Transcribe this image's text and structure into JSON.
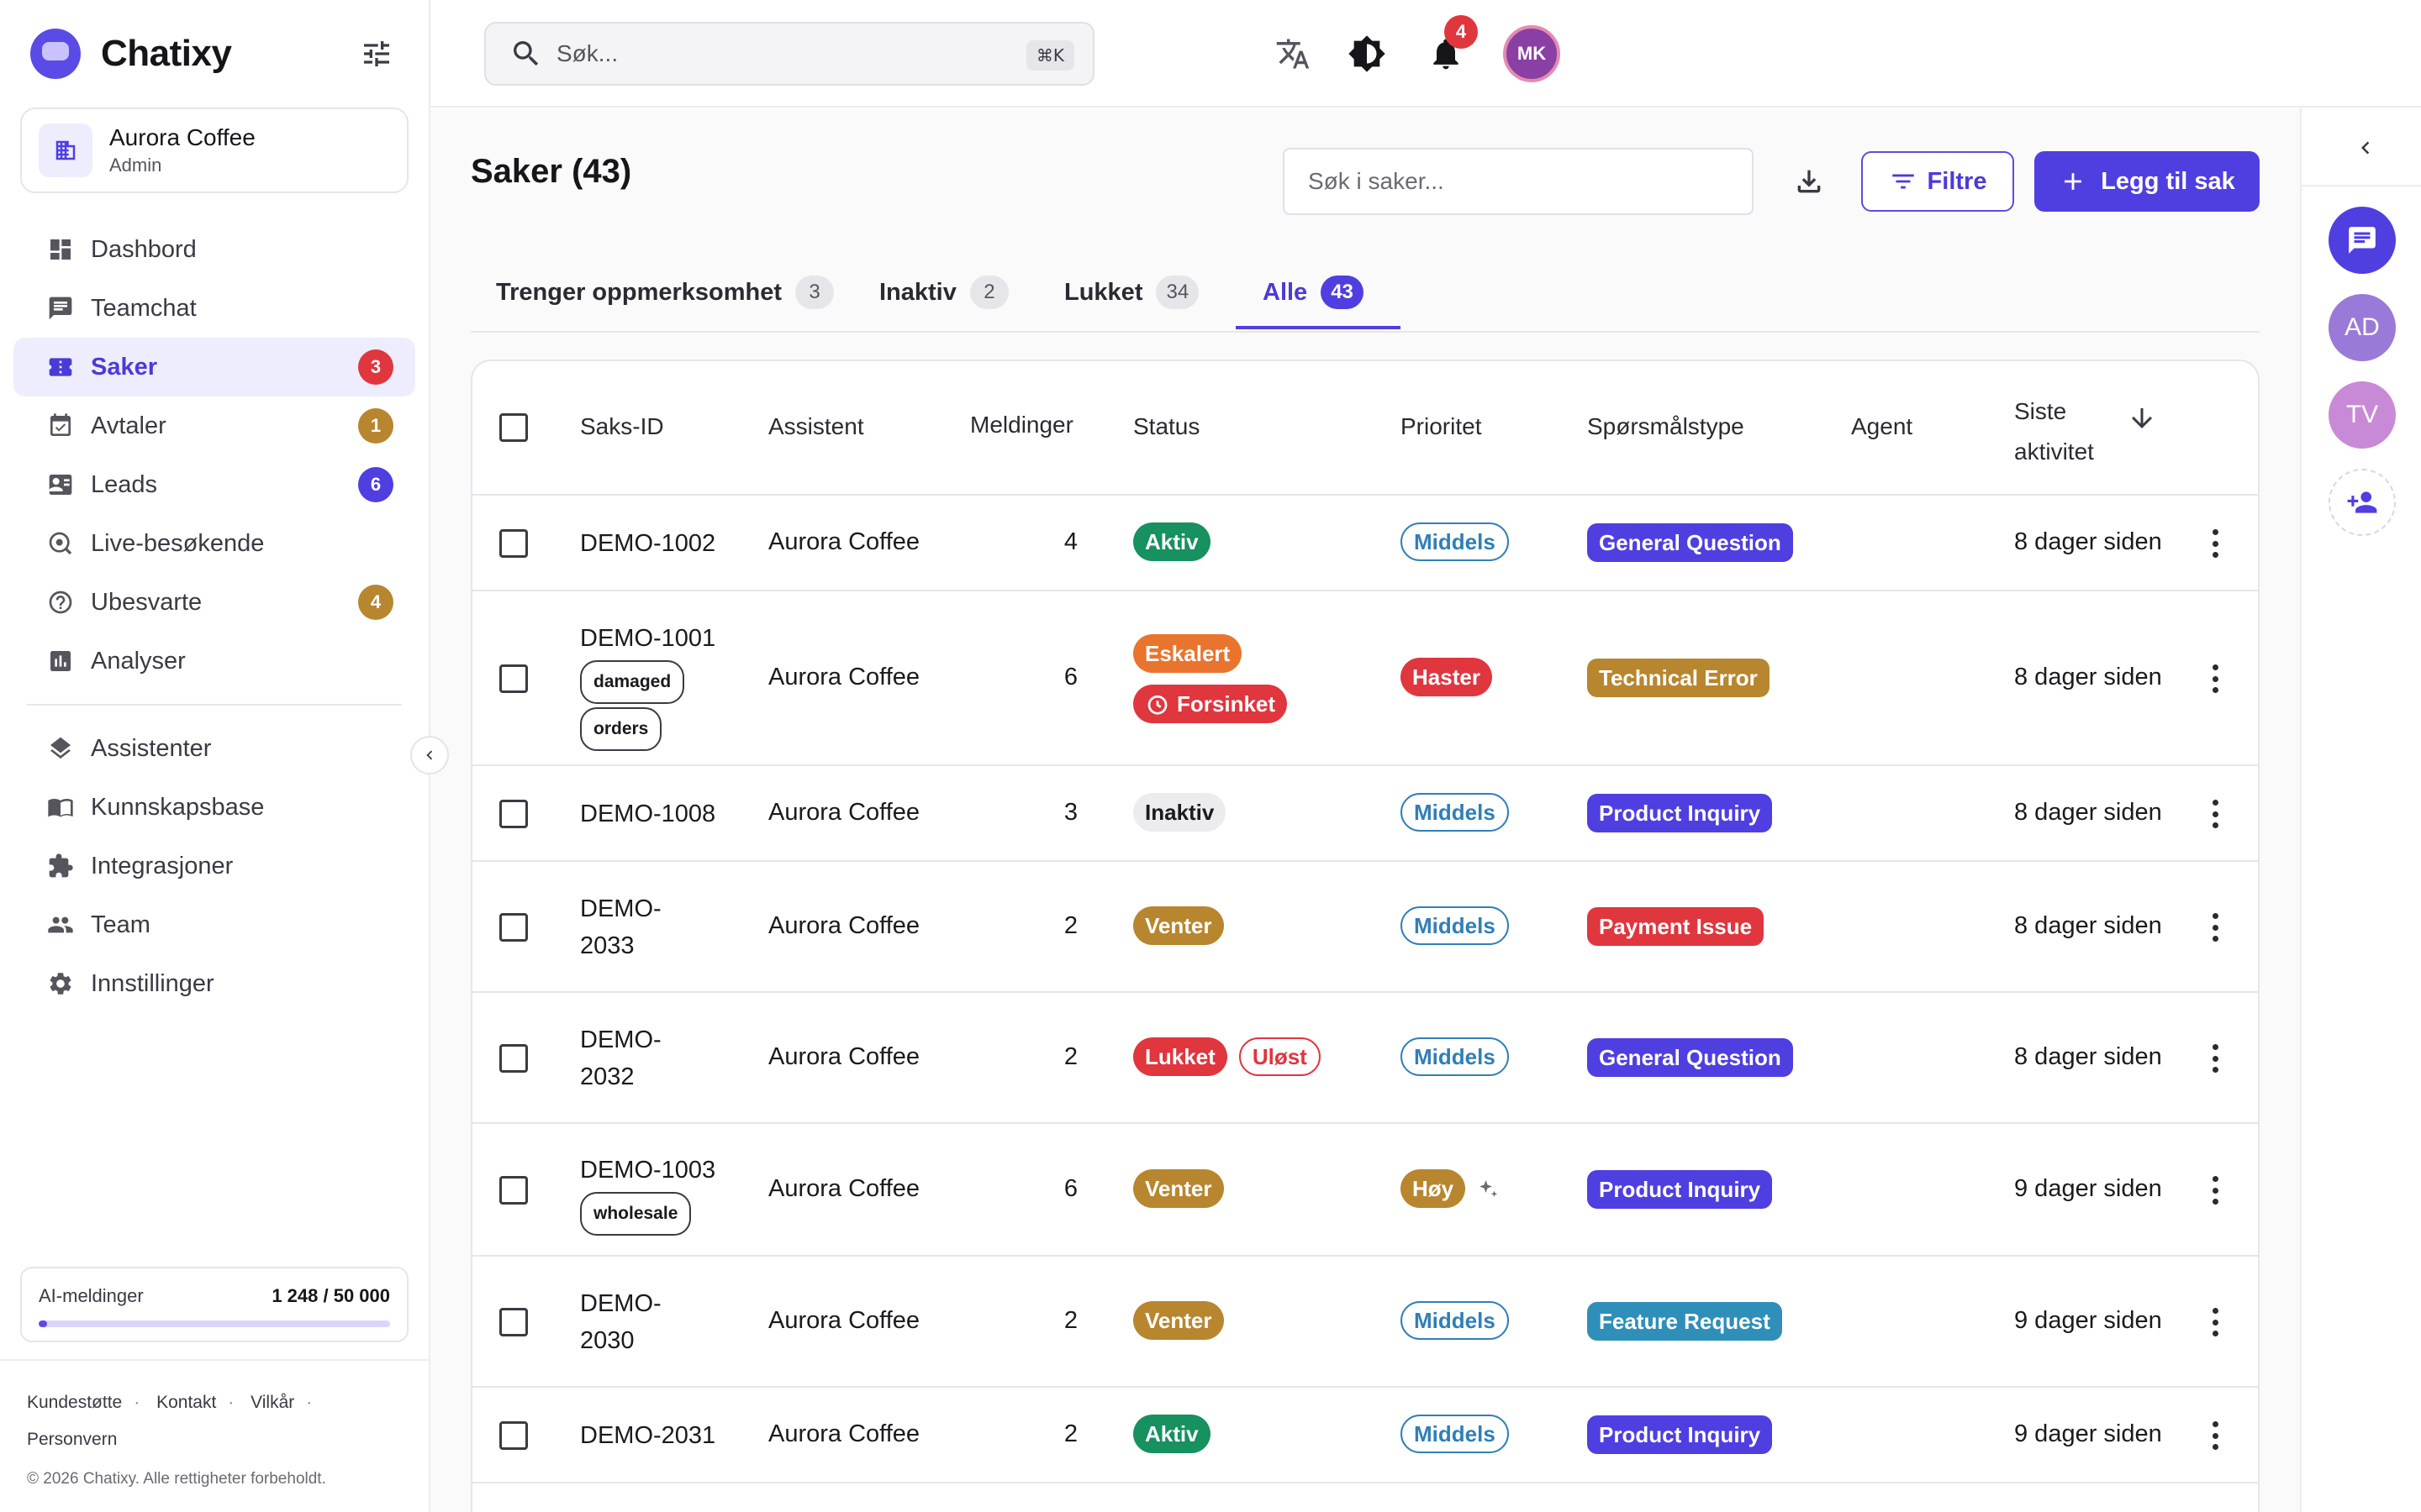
{
  "brand": {
    "name": "Chatixy"
  },
  "org": {
    "name": "Aurora Coffee",
    "role": "Admin"
  },
  "nav": {
    "items": [
      {
        "label": "Dashbord",
        "icon": "dashboard-icon"
      },
      {
        "label": "Teamchat",
        "icon": "chat-icon"
      },
      {
        "label": "Saker",
        "icon": "ticket-icon",
        "badge": "3",
        "active": true
      },
      {
        "label": "Avtaler",
        "icon": "calendar-icon",
        "badge": "1"
      },
      {
        "label": "Leads",
        "icon": "contact-card-icon",
        "badge": "6"
      },
      {
        "label": "Live-besøkende",
        "icon": "live-visitors-icon"
      },
      {
        "label": "Ubesvarte",
        "icon": "question-icon",
        "badge": "4"
      },
      {
        "label": "Analyser",
        "icon": "analytics-icon"
      }
    ],
    "items2": [
      {
        "label": "Assistenter",
        "icon": "layers-icon"
      },
      {
        "label": "Kunnskapsbase",
        "icon": "book-icon"
      },
      {
        "label": "Integrasjoner",
        "icon": "puzzle-icon"
      },
      {
        "label": "Team",
        "icon": "team-icon"
      },
      {
        "label": "Innstillinger",
        "icon": "gear-icon"
      }
    ]
  },
  "usage": {
    "label": "AI-meldinger",
    "value": "1 248 / 50 000",
    "fraction": 0.025
  },
  "footer": {
    "links": [
      "Kundestøtte",
      "Kontakt",
      "Vilkår",
      "Personvern"
    ],
    "copyright": "© 2026 Chatixy. Alle rettigheter forbeholdt."
  },
  "topbar": {
    "search_placeholder": "Søk...",
    "shortcut": "⌘K",
    "notification_count": "4",
    "avatar_initials": "MK"
  },
  "rail": {
    "avatars": [
      {
        "initials": "AD",
        "color": "#9a7ad8"
      },
      {
        "initials": "TV",
        "color": "#c88ad6"
      }
    ]
  },
  "page": {
    "title": "Saker (43)",
    "search_placeholder": "Søk i saker...",
    "filter_label": "Filtre",
    "add_label": "Legg til sak"
  },
  "tabs": [
    {
      "label": "Trenger oppmerksomhet",
      "count": "3"
    },
    {
      "label": "Inaktiv",
      "count": "2"
    },
    {
      "label": "Lukket",
      "count": "34"
    },
    {
      "label": "Alle",
      "count": "43",
      "active": true
    }
  ],
  "table": {
    "headers": {
      "id": "Saks-ID",
      "assistant": "Assistent",
      "messages": "Meldinger",
      "status": "Status",
      "priority": "Prioritet",
      "type": "Spørsmålstype",
      "agent": "Agent",
      "activity_line1": "Siste",
      "activity_line2": "aktivitet"
    },
    "rows": [
      {
        "id": "DEMO-1002",
        "tags": [],
        "assistant": "Aurora Coffee",
        "messages": "4",
        "status": [
          {
            "label": "Aktiv",
            "kind": "green"
          }
        ],
        "priority": {
          "label": "Middels",
          "kind": "outline"
        },
        "type": {
          "label": "General Question",
          "color": "#4f3fe0"
        },
        "activity": "8 dager siden"
      },
      {
        "id": "DEMO-1001",
        "tags": [
          "damaged",
          "orders"
        ],
        "assistant": "Aurora Coffee",
        "messages": "6",
        "status": [
          {
            "label": "Eskalert",
            "kind": "orange"
          },
          {
            "label": "Forsinket",
            "kind": "red-clock"
          }
        ],
        "priority": {
          "label": "Haster",
          "kind": "red"
        },
        "type": {
          "label": "Technical Error",
          "color": "#b8862e"
        },
        "activity": "8 dager siden"
      },
      {
        "id": "DEMO-1008",
        "tags": [],
        "assistant": "Aurora Coffee",
        "messages": "3",
        "status": [
          {
            "label": "Inaktiv",
            "kind": "grey"
          }
        ],
        "priority": {
          "label": "Middels",
          "kind": "outline"
        },
        "type": {
          "label": "Product Inquiry",
          "color": "#4f3fe0"
        },
        "activity": "8 dager siden"
      },
      {
        "id_line1": "DEMO-",
        "id_line2": "2033",
        "tags": [],
        "assistant": "Aurora Coffee",
        "messages": "2",
        "status": [
          {
            "label": "Venter",
            "kind": "amber"
          }
        ],
        "priority": {
          "label": "Middels",
          "kind": "outline"
        },
        "type": {
          "label": "Payment Issue",
          "color": "#e0363e"
        },
        "activity": "8 dager siden"
      },
      {
        "id_line1": "DEMO-",
        "id_line2": "2032",
        "tags": [],
        "assistant": "Aurora Coffee",
        "messages": "2",
        "status": [
          {
            "label": "Lukket",
            "kind": "red"
          },
          {
            "label": "Uløst",
            "kind": "red-outline"
          }
        ],
        "priority": {
          "label": "Middels",
          "kind": "outline"
        },
        "type": {
          "label": "General Question",
          "color": "#4f3fe0"
        },
        "activity": "8 dager siden"
      },
      {
        "id": "DEMO-1003",
        "tags": [
          "wholesale"
        ],
        "assistant": "Aurora Coffee",
        "messages": "6",
        "status": [
          {
            "label": "Venter",
            "kind": "amber"
          }
        ],
        "priority": {
          "label": "Høy",
          "kind": "amber",
          "ai": true
        },
        "type": {
          "label": "Product Inquiry",
          "color": "#4f3fe0"
        },
        "activity": "9 dager siden"
      },
      {
        "id_line1": "DEMO-",
        "id_line2": "2030",
        "tags": [],
        "assistant": "Aurora Coffee",
        "messages": "2",
        "status": [
          {
            "label": "Venter",
            "kind": "amber"
          }
        ],
        "priority": {
          "label": "Middels",
          "kind": "outline"
        },
        "type": {
          "label": "Feature Request",
          "color": "#2f8fb8"
        },
        "activity": "9 dager siden"
      },
      {
        "id": "DEMO-2031",
        "tags": [],
        "assistant": "Aurora Coffee",
        "messages": "2",
        "status": [
          {
            "label": "Aktiv",
            "kind": "green"
          }
        ],
        "priority": {
          "label": "Middels",
          "kind": "outline"
        },
        "type": {
          "label": "Product Inquiry",
          "color": "#4f3fe0"
        },
        "activity": "9 dager siden"
      }
    ]
  },
  "colors": {
    "accent": "#4f3fe0",
    "badge_red": "#e0363e",
    "badge_amber": "#b8862e",
    "badge_blue": "#4f3fe0",
    "status_green": "#16915f"
  }
}
